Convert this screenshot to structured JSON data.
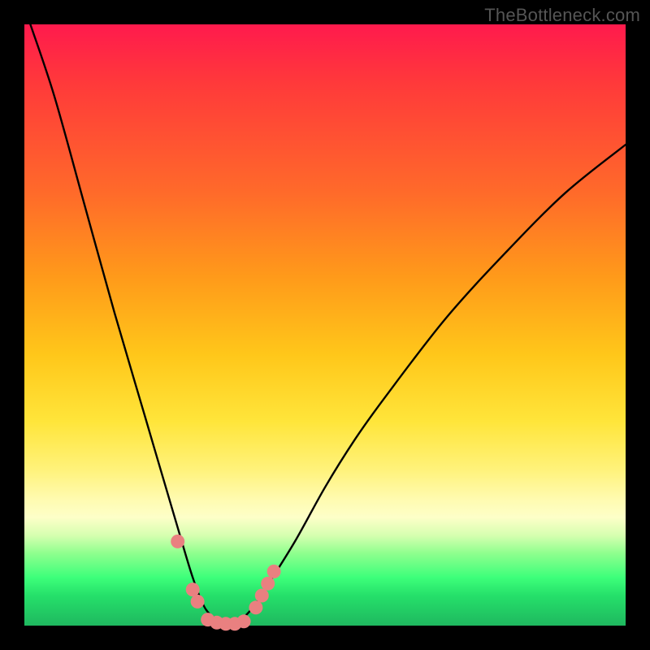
{
  "watermark": "TheBottleneck.com",
  "colors": {
    "frame": "#000000",
    "gradient_top": "#ff1a4d",
    "gradient_mid": "#ffe53a",
    "gradient_green": "#25e06a",
    "curve_stroke": "#000000",
    "marker_fill": "#e98080",
    "marker_stroke": "#c66"
  },
  "chart_data": {
    "type": "line",
    "title": "",
    "xlabel": "",
    "ylabel": "",
    "xlim": [
      0,
      100
    ],
    "ylim": [
      0,
      100
    ],
    "note": "V-shaped bottleneck curve; y is bottleneck %, minimum ≈0 near x≈34. Values estimated from pixels.",
    "series": [
      {
        "name": "bottleneck-curve",
        "x": [
          1,
          5,
          10,
          15,
          20,
          25,
          28,
          30,
          32,
          34,
          36,
          38,
          40,
          45,
          50,
          55,
          60,
          70,
          80,
          90,
          100
        ],
        "y": [
          100,
          88,
          70,
          52,
          35,
          18,
          8,
          3,
          1,
          0,
          1,
          3,
          6,
          14,
          23,
          31,
          38,
          51,
          62,
          72,
          80
        ]
      }
    ],
    "markers": {
      "name": "highlighted-points",
      "note": "Salmon dots clustered around the curve minimum; positions estimated.",
      "points": [
        {
          "x": 25.5,
          "y": 14
        },
        {
          "x": 28.0,
          "y": 6
        },
        {
          "x": 28.8,
          "y": 4
        },
        {
          "x": 30.5,
          "y": 1
        },
        {
          "x": 32.0,
          "y": 0.5
        },
        {
          "x": 33.5,
          "y": 0.3
        },
        {
          "x": 35.0,
          "y": 0.3
        },
        {
          "x": 36.5,
          "y": 0.7
        },
        {
          "x": 38.5,
          "y": 3
        },
        {
          "x": 39.5,
          "y": 5
        },
        {
          "x": 40.5,
          "y": 7
        },
        {
          "x": 41.5,
          "y": 9
        }
      ]
    }
  }
}
